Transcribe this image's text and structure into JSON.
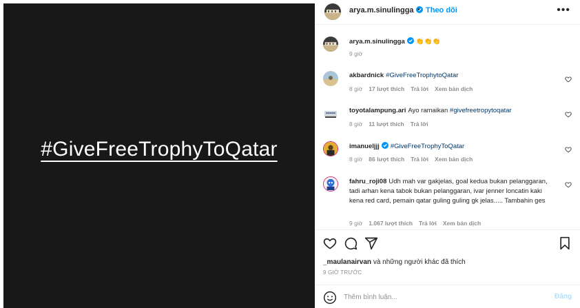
{
  "media": {
    "caption_text": "#GiveFreeTrophyToQatar",
    "background": "#181818"
  },
  "header": {
    "username": "arya.m.sinulingga",
    "dot": "•",
    "follow_label": "Theo dõi",
    "more_label": "•••"
  },
  "caption": {
    "username": "arya.m.sinulingga",
    "text": "👏👏👏",
    "time": "9 giờ"
  },
  "comments": [
    {
      "username": "akbardnick",
      "text": "#GiveFreeTrophytoQatar",
      "time": "8 giờ",
      "likes": "17 lượt thích",
      "reply": "Trả lời",
      "translate": "Xem bản dịch"
    },
    {
      "username": "toyotalampung.ari",
      "text_plain": "Ayo ramaikan",
      "text_tag": "#givefreetropytoqatar",
      "time": "8 giờ",
      "likes": "11 lượt thích",
      "reply": "Trả lời"
    },
    {
      "username": "imanueljjj",
      "text": "#GiveFreeTrophyToQatar",
      "time": "8 giờ",
      "likes": "86 lượt thích",
      "reply": "Trả lời",
      "translate": "Xem bản dịch"
    },
    {
      "username": "fahru_roji08",
      "text": "Udh mah var gakjelas, goal kedua bukan pelanggaran, tadi arhan kena tabok bukan pelanggaran, ivar jenner loncatin kaki kena red card, pemain qatar guling guling gk jelas..... Tambahin ges",
      "time": "9 giờ",
      "likes": "1.067 lượt thích",
      "reply": "Trả lời",
      "translate": "Xem bản dịch"
    }
  ],
  "likes_summary": {
    "user": "_maulanairvan",
    "rest": " và những người khác đã thích"
  },
  "time_ago": "9 GIỜ TRƯỚC",
  "composer": {
    "placeholder": "Thêm bình luận...",
    "post_label": "Đăng"
  },
  "colors": {
    "link": "#0095f6",
    "hashtag": "#00376b",
    "muted": "#8e8e8e",
    "verified": "#0095f6"
  },
  "icons": [
    "heart-icon",
    "comment-icon",
    "share-icon",
    "bookmark-icon",
    "emoji-icon",
    "verified-badge-icon",
    "more-icon"
  ]
}
